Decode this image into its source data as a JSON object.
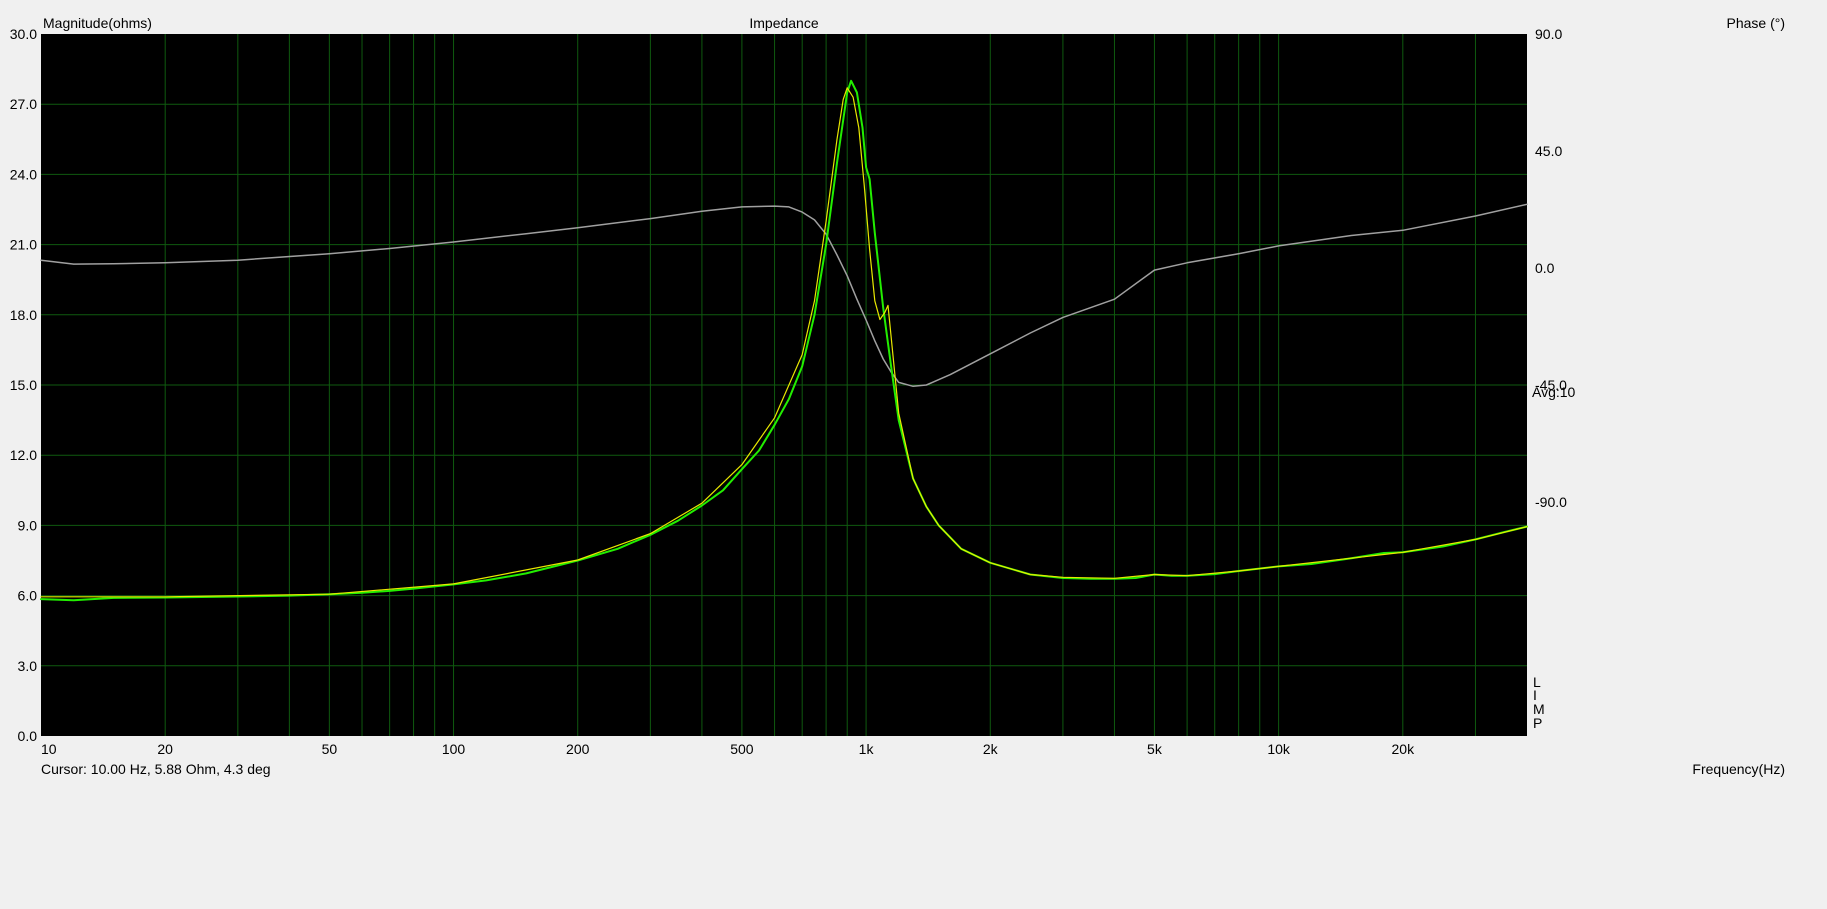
{
  "window": {
    "title": "Impedance",
    "left_axis_label": "Magnitude(ohms)",
    "right_axis_label": "Phase (°)",
    "x_axis_label": "Frequency(Hz)",
    "cursor_readout": "Cursor: 10.00 Hz, 5.88 Ohm, 4.3 deg",
    "avg_label": "Avg:10",
    "side_letters": [
      "L",
      "I",
      "M",
      "P"
    ]
  },
  "colors": {
    "plot_background": "#000000",
    "grid": "#0f5a0f",
    "series_green": "#22ee00",
    "series_yellow": "#e8e800",
    "series_phase": "#a0a0a0",
    "page_background": "#f0f0f0"
  },
  "chart_data": {
    "type": "line",
    "title": "Impedance",
    "xlabel": "Frequency(Hz)",
    "ylabel": "Magnitude(ohms)",
    "y2label": "Phase (°)",
    "xscale": "log",
    "xlim": [
      10,
      40000
    ],
    "ylim": [
      0,
      30
    ],
    "y2lim": [
      -180,
      90
    ],
    "grid": true,
    "x_ticks": [
      {
        "value": 10,
        "label": "10"
      },
      {
        "value": 20,
        "label": "20"
      },
      {
        "value": 50,
        "label": "50"
      },
      {
        "value": 100,
        "label": "100"
      },
      {
        "value": 200,
        "label": "200"
      },
      {
        "value": 500,
        "label": "500"
      },
      {
        "value": 1000,
        "label": "1k"
      },
      {
        "value": 2000,
        "label": "2k"
      },
      {
        "value": 5000,
        "label": "5k"
      },
      {
        "value": 10000,
        "label": "10k"
      },
      {
        "value": 20000,
        "label": "20k"
      }
    ],
    "x_minor_grid": [
      30,
      40,
      60,
      70,
      80,
      90,
      300,
      400,
      600,
      700,
      800,
      900,
      3000,
      4000,
      6000,
      7000,
      8000,
      9000,
      30000
    ],
    "y_ticks": [
      {
        "value": 0,
        "label": "0.0"
      },
      {
        "value": 3,
        "label": "3.0"
      },
      {
        "value": 6,
        "label": "6.0"
      },
      {
        "value": 9,
        "label": "9.0"
      },
      {
        "value": 12,
        "label": "12.0"
      },
      {
        "value": 15,
        "label": "15.0"
      },
      {
        "value": 18,
        "label": "18.0"
      },
      {
        "value": 21,
        "label": "21.0"
      },
      {
        "value": 24,
        "label": "24.0"
      },
      {
        "value": 27,
        "label": "27.0"
      },
      {
        "value": 30,
        "label": "30.0"
      }
    ],
    "y2_ticks": [
      {
        "value": 90,
        "label": "90.0"
      },
      {
        "value": 45,
        "label": "45.0"
      },
      {
        "value": 0,
        "label": "0.0"
      },
      {
        "value": -45,
        "label": "-45.0"
      },
      {
        "value": -90,
        "label": "-90.0"
      }
    ],
    "series": [
      {
        "axis": "left",
        "color": "#22ee00",
        "width": 2,
        "points": [
          [
            10,
            5.85
          ],
          [
            12,
            5.8
          ],
          [
            15,
            5.9
          ],
          [
            20,
            5.92
          ],
          [
            30,
            5.96
          ],
          [
            40,
            6.0
          ],
          [
            50,
            6.06
          ],
          [
            60,
            6.12
          ],
          [
            70,
            6.2
          ],
          [
            80,
            6.3
          ],
          [
            100,
            6.48
          ],
          [
            120,
            6.65
          ],
          [
            150,
            6.95
          ],
          [
            200,
            7.5
          ],
          [
            250,
            8.0
          ],
          [
            300,
            8.6
          ],
          [
            350,
            9.2
          ],
          [
            400,
            9.85
          ],
          [
            450,
            10.5
          ],
          [
            500,
            11.4
          ],
          [
            550,
            12.2
          ],
          [
            600,
            13.3
          ],
          [
            650,
            14.4
          ],
          [
            700,
            15.8
          ],
          [
            750,
            18.0
          ],
          [
            800,
            21.0
          ],
          [
            850,
            24.5
          ],
          [
            900,
            27.5
          ],
          [
            920,
            28.0
          ],
          [
            950,
            27.5
          ],
          [
            980,
            26.0
          ],
          [
            1000,
            24.3
          ],
          [
            1020,
            23.8
          ],
          [
            1050,
            21.5
          ],
          [
            1100,
            18.3
          ],
          [
            1150,
            15.8
          ],
          [
            1200,
            13.5
          ],
          [
            1300,
            11.0
          ],
          [
            1400,
            9.8
          ],
          [
            1500,
            9.0
          ],
          [
            1700,
            8.0
          ],
          [
            2000,
            7.4
          ],
          [
            2500,
            6.9
          ],
          [
            3000,
            6.75
          ],
          [
            3500,
            6.72
          ],
          [
            4000,
            6.72
          ],
          [
            4500,
            6.75
          ],
          [
            5000,
            6.9
          ],
          [
            5500,
            6.85
          ],
          [
            6000,
            6.85
          ],
          [
            7000,
            6.92
          ],
          [
            8000,
            7.05
          ],
          [
            10000,
            7.25
          ],
          [
            12000,
            7.35
          ],
          [
            15000,
            7.6
          ],
          [
            18000,
            7.82
          ],
          [
            20000,
            7.85
          ],
          [
            25000,
            8.1
          ],
          [
            30000,
            8.4
          ],
          [
            35000,
            8.7
          ],
          [
            40000,
            8.95
          ]
        ]
      },
      {
        "axis": "left",
        "color": "#e8e800",
        "width": 1.2,
        "points": [
          [
            10,
            5.95
          ],
          [
            20,
            5.95
          ],
          [
            50,
            6.06
          ],
          [
            100,
            6.5
          ],
          [
            200,
            7.52
          ],
          [
            300,
            8.65
          ],
          [
            400,
            9.95
          ],
          [
            500,
            11.6
          ],
          [
            600,
            13.6
          ],
          [
            700,
            16.3
          ],
          [
            750,
            18.6
          ],
          [
            800,
            22.0
          ],
          [
            850,
            25.5
          ],
          [
            880,
            27.2
          ],
          [
            900,
            27.7
          ],
          [
            930,
            27.3
          ],
          [
            960,
            26.0
          ],
          [
            990,
            23.5
          ],
          [
            1020,
            20.8
          ],
          [
            1050,
            18.6
          ],
          [
            1080,
            17.8
          ],
          [
            1110,
            18.1
          ],
          [
            1130,
            18.4
          ],
          [
            1200,
            13.8
          ],
          [
            1300,
            11.0
          ],
          [
            1400,
            9.8
          ],
          [
            1500,
            9.0
          ],
          [
            1700,
            8.0
          ],
          [
            2000,
            7.4
          ],
          [
            2500,
            6.9
          ],
          [
            3000,
            6.78
          ],
          [
            4000,
            6.74
          ],
          [
            5000,
            6.9
          ],
          [
            6000,
            6.85
          ],
          [
            8000,
            7.05
          ],
          [
            10000,
            7.25
          ],
          [
            15000,
            7.6
          ],
          [
            20000,
            7.85
          ],
          [
            30000,
            8.4
          ],
          [
            40000,
            8.95
          ]
        ]
      },
      {
        "axis": "right",
        "color": "#a0a0a0",
        "width": 1.5,
        "points": [
          [
            10,
            3.0
          ],
          [
            12,
            1.5
          ],
          [
            15,
            1.6
          ],
          [
            20,
            2.0
          ],
          [
            30,
            3.0
          ],
          [
            50,
            5.5
          ],
          [
            70,
            7.5
          ],
          [
            100,
            10.0
          ],
          [
            150,
            13.2
          ],
          [
            200,
            15.5
          ],
          [
            300,
            19.0
          ],
          [
            400,
            21.8
          ],
          [
            500,
            23.5
          ],
          [
            600,
            23.8
          ],
          [
            650,
            23.5
          ],
          [
            700,
            21.5
          ],
          [
            750,
            18.5
          ],
          [
            800,
            13.0
          ],
          [
            850,
            5.0
          ],
          [
            900,
            -3.0
          ],
          [
            950,
            -12.0
          ],
          [
            1000,
            -20.0
          ],
          [
            1050,
            -28.0
          ],
          [
            1100,
            -35.0
          ],
          [
            1150,
            -40.0
          ],
          [
            1200,
            -44.0
          ],
          [
            1300,
            -45.5
          ],
          [
            1400,
            -45.0
          ],
          [
            1600,
            -41.0
          ],
          [
            2000,
            -33.0
          ],
          [
            2500,
            -25.0
          ],
          [
            3000,
            -19.0
          ],
          [
            4000,
            -12.0
          ],
          [
            5000,
            -0.8
          ],
          [
            6000,
            2.0
          ],
          [
            8000,
            5.5
          ],
          [
            10000,
            8.5
          ],
          [
            15000,
            12.5
          ],
          [
            20000,
            14.5
          ],
          [
            30000,
            20.0
          ],
          [
            40000,
            24.5
          ]
        ]
      }
    ]
  }
}
